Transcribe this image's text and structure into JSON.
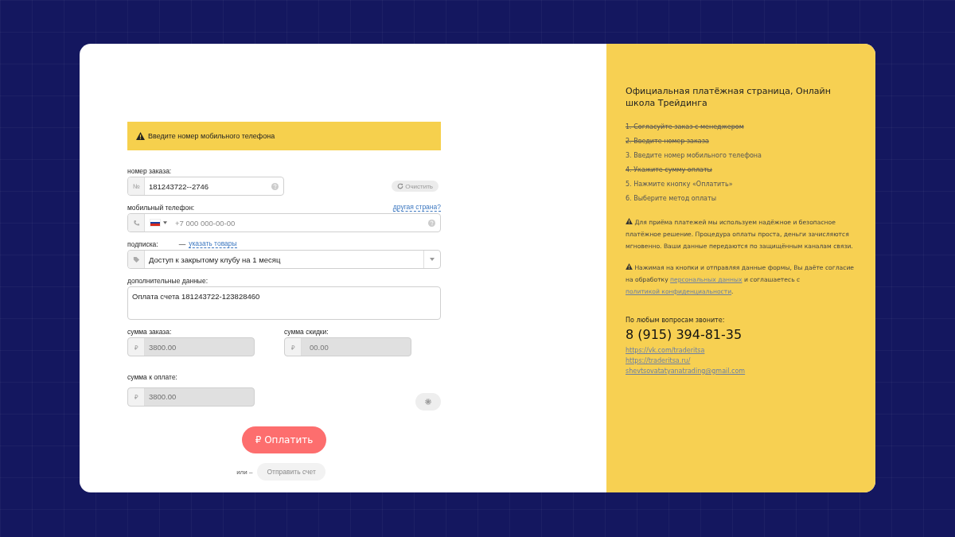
{
  "alert": {
    "text": "Введите номер мобильного телефона"
  },
  "order_field": {
    "label": "номер заказа:",
    "prefix": "№",
    "value": "181243722--2746"
  },
  "clear_button": {
    "label": "Очистить"
  },
  "phone_field": {
    "label": "мобильный телефон:",
    "other_country_link": "другая страна?",
    "placeholder": "+7 000 000-00-00"
  },
  "subscription_field": {
    "label": "подписка:",
    "dash": "—",
    "link": "указать товары",
    "value": "Доступ к закрытому клубу на 1 месяц"
  },
  "extra_field": {
    "label": "дополнительные данные:",
    "value": "Оплата счета 181243722-123828460"
  },
  "amount_fields": [
    {
      "label": "сумма заказа:",
      "prefix": "₽",
      "value": "3800.00",
      "disabled": true
    },
    {
      "label": "сумма скидки:",
      "prefix": "₽",
      "placeholder": "00.00",
      "disabled": true
    }
  ],
  "total_field": {
    "label": "сумма к оплате:",
    "prefix": "₽",
    "value": "3800.00",
    "disabled": true
  },
  "pay_button": {
    "label": "₽ Оплатить"
  },
  "or_text": "или –",
  "send_invoice_button": {
    "label": "Отправить счет"
  },
  "sidebar": {
    "title": "Официальная платёжная страница, Онлайн школа Трейдинга",
    "steps": [
      {
        "text": "1. Согласуйте заказ с менеджером",
        "done": true
      },
      {
        "text": "2. Введите номер заказа",
        "done": true
      },
      {
        "text": "3. Введите номер мобильного телефона",
        "done": false
      },
      {
        "text": "4. Укажите сумму оплаты",
        "done": true
      },
      {
        "text": "5. Нажмите кнопку «Оплатить»",
        "done": false
      },
      {
        "text": "6. Выберите метод оплаты",
        "done": false
      }
    ],
    "security_note": "Для приёма платежей мы используем надёжное и безопасное платёжное решение. Процедура оплаты проста, деньги зачисляются мгновенно. Ваши данные передаются по защищённым каналам связи.",
    "consent": {
      "before": "Нажимая на кнопки и отправляя данные формы, Вы даёте согласие на обработку",
      "link1": "персональных данных",
      "middle": "и соглашаетесь с",
      "link2": "политикой конфиденциальности",
      "after": "."
    },
    "contact_label": "По любым вопросам звоните:",
    "phone": "8 (915) 394-81-35",
    "links": [
      "https://vk.com/traderitsa",
      "https://traderitsa.ru/",
      "shevtsovatatyanatrading@gmail.com"
    ]
  }
}
